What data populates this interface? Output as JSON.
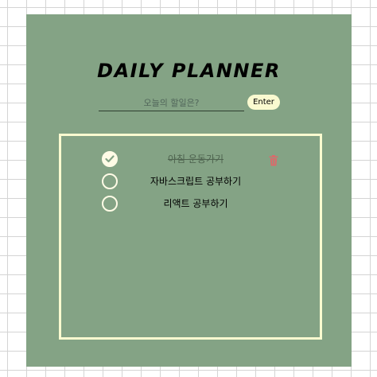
{
  "planner": {
    "title": "DAILY PLANNER",
    "input": {
      "placeholder": "오늘의 할일은?",
      "value": ""
    },
    "enter_label": "Enter",
    "colors": {
      "panel": "#84a385",
      "accent": "#fafad0",
      "delete": "#d96b6b"
    },
    "todos": [
      {
        "text": "아침 운동가기",
        "done": true,
        "show_delete": true
      },
      {
        "text": "자바스크립트 공부하기",
        "done": false,
        "show_delete": false
      },
      {
        "text": "리액트 공부하기",
        "done": false,
        "show_delete": false
      }
    ]
  }
}
